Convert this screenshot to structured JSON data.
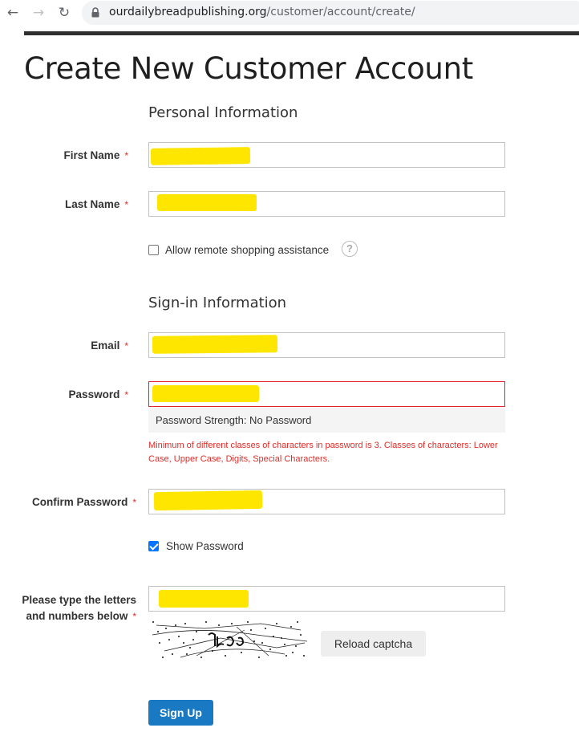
{
  "browser": {
    "url_domain": "ourdailybreadpublishing.org",
    "url_path": "/customer/account/create/",
    "back_icon": "arrow-left-icon",
    "forward_icon": "arrow-right-icon",
    "reload_icon": "reload-icon"
  },
  "page": {
    "title": "Create New Customer Account"
  },
  "personal": {
    "legend": "Personal Information",
    "first_name_label": "First Name",
    "last_name_label": "Last Name",
    "required_mark": "*",
    "remote_assist_label": "Allow remote shopping assistance",
    "remote_assist_checked": false,
    "help_icon": "question-circle-icon"
  },
  "signin": {
    "legend": "Sign-in Information",
    "email_label": "Email",
    "password_label": "Password",
    "password_strength": "Password Strength: No Password",
    "password_error": "Minimum of different classes of characters in password is 3. Classes of characters: Lower Case, Upper Case, Digits, Special Characters.",
    "confirm_password_label": "Confirm Password",
    "show_password_label": "Show Password",
    "show_password_checked": true
  },
  "captcha": {
    "label": "Please type the letters and numbers below",
    "reload_label": "Reload captcha"
  },
  "actions": {
    "signup_label": "Sign Up"
  },
  "colors": {
    "primary": "#1979c3",
    "error": "#e02b27",
    "redaction": "#ffe600"
  }
}
